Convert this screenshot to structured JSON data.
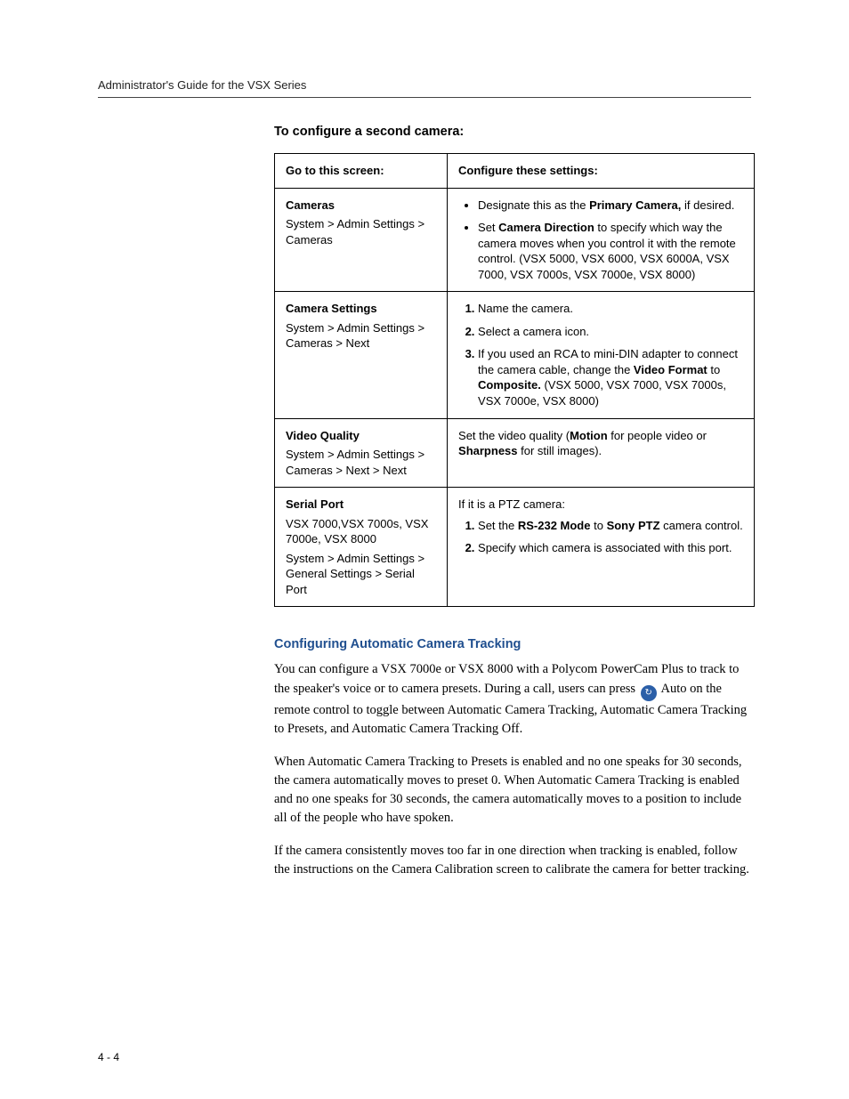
{
  "header": {
    "running_head": "Administrator's Guide for the VSX Series"
  },
  "procedure_title": "To configure a second camera:",
  "table": {
    "head": {
      "left": "Go to this screen:",
      "right": "Configure these settings:"
    },
    "rows": {
      "cameras": {
        "title": "Cameras",
        "path": "System > Admin Settings > Cameras",
        "b1a": "Designate this as the ",
        "b1b": "Primary Camera,",
        "b1c": " if desired.",
        "b2a": "Set ",
        "b2b": "Camera Direction",
        "b2c": " to specify which way the camera moves when you control it with the remote control. (VSX 5000, VSX 6000, VSX 6000A, VSX 7000, VSX 7000s, VSX 7000e, VSX 8000)"
      },
      "camera_settings": {
        "title": "Camera Settings",
        "path": "System > Admin Settings > Cameras > Next",
        "s1": "Name the camera.",
        "s2": "Select a camera icon.",
        "s3a": "If you used an RCA to mini-DIN adapter to connect the camera cable, change the ",
        "s3b": "Video Format",
        "s3c": " to ",
        "s3d": "Composite.",
        "s3e": " (VSX 5000, VSX 7000, VSX 7000s, VSX 7000e, VSX 8000)"
      },
      "video_quality": {
        "title": "Video Quality",
        "path": "System > Admin Settings > Cameras > Next > Next",
        "r1a": "Set the video quality (",
        "r1b": "Motion",
        "r1c": " for people video or ",
        "r1d": "Sharpness",
        "r1e": " for still images)."
      },
      "serial_port": {
        "title": "Serial Port",
        "models": "VSX 7000,VSX 7000s, VSX 7000e, VSX 8000",
        "path": "System > Admin Settings > General Settings > Serial Port",
        "intro": "If it is a PTZ camera:",
        "s1a": "Set the ",
        "s1b": "RS-232 Mode",
        "s1c": " to ",
        "s1d": "Sony PTZ",
        "s1e": " camera control.",
        "s2": "Specify which camera is associated with this port."
      }
    }
  },
  "subsection": {
    "title": "Configuring Automatic Camera Tracking",
    "p1a": "You can configure a VSX 7000e or VSX 8000 with a Polycom PowerCam Plus to track to the speaker's voice or to camera presets. During a call, users can press ",
    "p1b": " Auto on the remote control to toggle between Automatic Camera Tracking, Automatic Camera Tracking to Presets, and Automatic Camera Tracking Off.",
    "p2": "When Automatic Camera Tracking to Presets is enabled and no one speaks for 30 seconds, the camera automatically moves to preset 0. When Automatic Camera Tracking is enabled and no one speaks for 30 seconds, the camera automatically moves to a position to include all of the people who have spoken.",
    "p3": "If the camera consistently moves too far in one direction when tracking is enabled, follow the instructions on the Camera Calibration screen to calibrate the camera for better tracking."
  },
  "icons": {
    "auto_glyph": "↻"
  },
  "page_number": "4 - 4"
}
